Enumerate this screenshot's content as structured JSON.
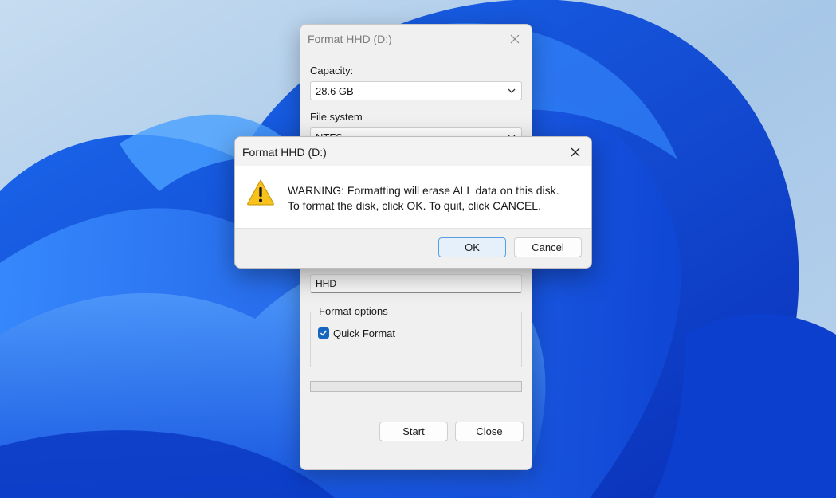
{
  "desktop": {
    "wallpaper": "bloom-wallpaper"
  },
  "format_dialog": {
    "title": "Format HHD (D:)",
    "capacity_label": "Capacity:",
    "capacity_value": "28.6 GB",
    "file_system_label": "File system",
    "file_system_value": "NTFS",
    "volume_label_value": "HHD",
    "format_options_label": "Format options",
    "quick_format_label": "Quick Format",
    "quick_format_checked": true,
    "progress": 0,
    "start_label": "Start",
    "close_label": "Close"
  },
  "warning_dialog": {
    "title": "Format HHD (D:)",
    "line1": "WARNING: Formatting will erase ALL data on this disk.",
    "line2": "To format the disk, click OK. To quit, click CANCEL.",
    "ok_label": "OK",
    "cancel_label": "Cancel",
    "icon": "warning-icon"
  },
  "colors": {
    "accent": "#1665c1",
    "warning": "#f7c21c",
    "ok_border": "#5a9de0"
  }
}
